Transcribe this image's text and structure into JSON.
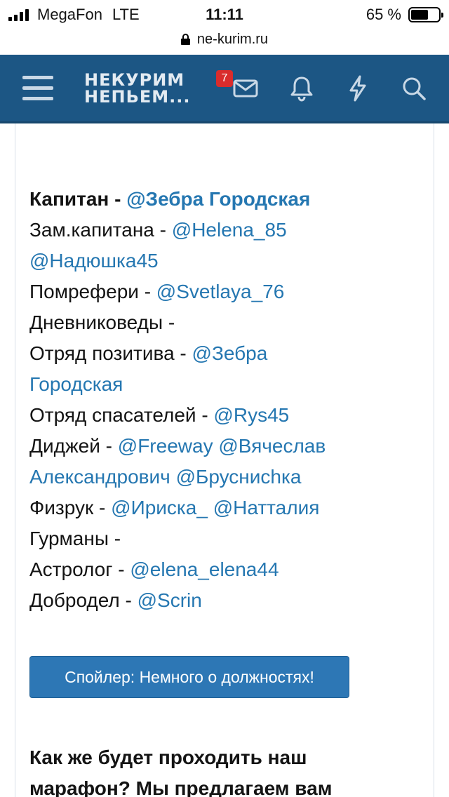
{
  "status_bar": {
    "carrier": "MegaFon",
    "network": "LTE",
    "time": "11:11",
    "battery": "65 %"
  },
  "url_bar": {
    "domain": "ne-kurim.ru",
    "icon": "lock-icon"
  },
  "header": {
    "logo_line1": "НЕКУРИМ",
    "logo_line2": "НЕПЬЕМ...",
    "messages_badge": "7",
    "icons": [
      "menu-icon",
      "mail-icon",
      "bell-icon",
      "bolt-icon",
      "search-icon"
    ],
    "background_color": "#1c5684"
  },
  "post": {
    "lines": [
      {
        "label": "Капитан - ",
        "mentions": [
          "@Зебра Городская"
        ]
      },
      {
        "label": "Зам.капитана - ",
        "mentions": [
          "@Helena_85"
        ]
      },
      {
        "label": "",
        "mentions": [
          "@Надюшка45"
        ]
      },
      {
        "label": "Помрефери - ",
        "mentions": [
          "@Svetlaya_76"
        ]
      },
      {
        "label": "Дневниковеды -",
        "mentions": []
      },
      {
        "label": "Отряд позитива - ",
        "mentions": [
          "@Зебра"
        ]
      },
      {
        "label": "",
        "mentions": [
          "Городская"
        ]
      },
      {
        "label": "Отряд спасателей - ",
        "mentions": [
          "@Rys45"
        ]
      },
      {
        "label": "Диджей - ",
        "mentions": [
          "@Freeway",
          "@Вячеслав"
        ]
      },
      {
        "label": "",
        "mentions": [
          "Александрович",
          "@Бруснисhка"
        ]
      },
      {
        "label": "Физрук - ",
        "mentions": [
          "@Ириска_",
          "@Натталия"
        ]
      },
      {
        "label": "Гурманы -",
        "mentions": []
      },
      {
        "label": "Астролог - ",
        "mentions": [
          "@elena_elena44"
        ]
      },
      {
        "label": "Добродел - ",
        "mentions": [
          "@Scrin"
        ]
      }
    ],
    "link_color": "#2577b1",
    "spoiler_button": "Спойлер: Немного о должностях!",
    "heading_line1": "Как же будет проходить наш",
    "heading_line2": "марафон? Мы предлагаем вам"
  }
}
